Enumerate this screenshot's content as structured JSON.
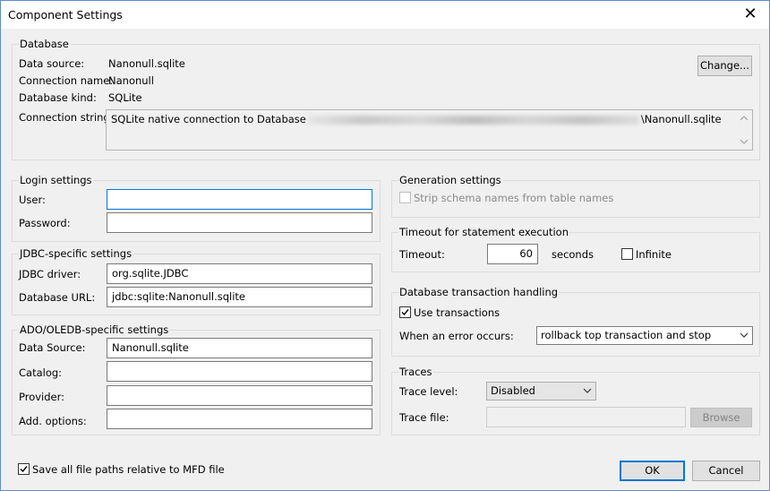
{
  "window": {
    "title": "Component Settings",
    "close_glyph": "✕"
  },
  "database": {
    "group_title": "Database",
    "data_source_label": "Data source:",
    "data_source_value": "Nanonull.sqlite",
    "connection_name_label": "Connection name:",
    "connection_name_value": "Nanonull",
    "database_kind_label": "Database kind:",
    "database_kind_value": "SQLite",
    "connection_string_label": "Connection string:",
    "connection_string_prefix": "SQLite native connection to Database",
    "connection_string_suffix": "\\Nanonull.sqlite",
    "change_button": "Change..."
  },
  "login": {
    "group_title": "Login settings",
    "user_label": "User:",
    "user_value": "",
    "password_label": "Password:",
    "password_value": ""
  },
  "jdbc": {
    "group_title": "JDBC-specific settings",
    "driver_label": "JDBC driver:",
    "driver_value": "org.sqlite.JDBC",
    "url_label": "Database URL:",
    "url_value": "jdbc:sqlite:Nanonull.sqlite"
  },
  "ado": {
    "group_title": "ADO/OLEDB-specific settings",
    "data_source_label": "Data Source:",
    "data_source_value": "Nanonull.sqlite",
    "catalog_label": "Catalog:",
    "catalog_value": "",
    "provider_label": "Provider:",
    "provider_value": "",
    "options_label": "Add. options:",
    "options_value": ""
  },
  "generation": {
    "group_title": "Generation settings",
    "strip_label": "Strip schema names from table names",
    "strip_checked": false
  },
  "timeout": {
    "group_title": "Timeout for statement execution",
    "timeout_label": "Timeout:",
    "timeout_value": "60",
    "seconds_label": "seconds",
    "infinite_label": "Infinite",
    "infinite_checked": false
  },
  "transaction": {
    "group_title": "Database transaction handling",
    "use_label": "Use transactions",
    "use_checked": true,
    "error_label": "When an error occurs:",
    "error_value": "rollback top transaction and stop"
  },
  "traces": {
    "group_title": "Traces",
    "level_label": "Trace level:",
    "level_value": "Disabled",
    "file_label": "Trace file:",
    "file_value": "",
    "browse_button": "Browse"
  },
  "footer": {
    "save_paths_label": "Save all file paths relative to MFD file",
    "save_paths_checked": true,
    "ok_button": "OK",
    "cancel_button": "Cancel"
  },
  "colors": {
    "accent": "#0078d7",
    "dialog_bg": "#f0f0f0",
    "border": "#dcdcdc"
  }
}
